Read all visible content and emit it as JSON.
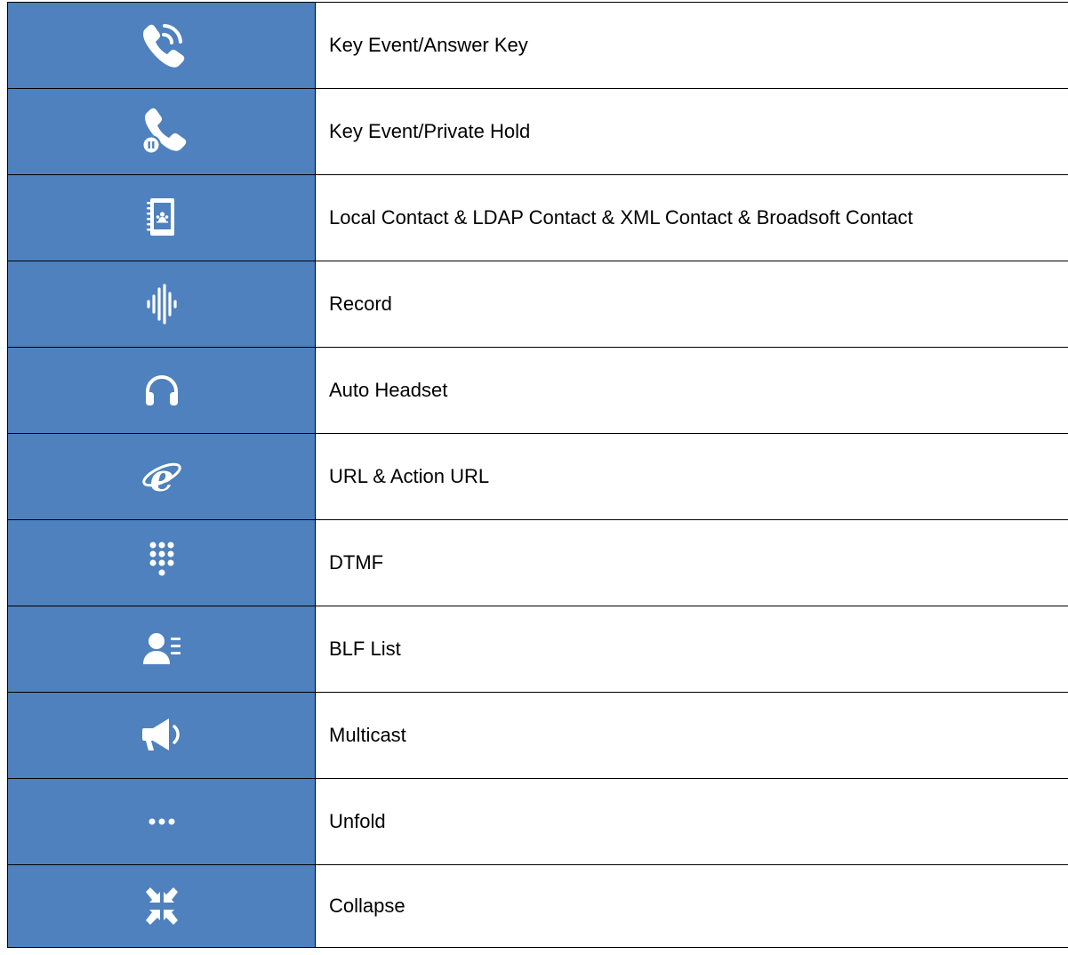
{
  "table": {
    "rows": [
      {
        "icon": "phone-answer-icon",
        "label": "Key Event/Answer Key"
      },
      {
        "icon": "phone-hold-icon",
        "label": "Key Event/Private Hold"
      },
      {
        "icon": "contact-book-icon",
        "label": "Local Contact & LDAP Contact & XML Contact & Broadsoft Contact"
      },
      {
        "icon": "sound-wave-icon",
        "label": "Record"
      },
      {
        "icon": "headset-icon",
        "label": "Auto Headset"
      },
      {
        "icon": "internet-explorer-icon",
        "label": "URL & Action URL"
      },
      {
        "icon": "dialpad-icon",
        "label": "DTMF"
      },
      {
        "icon": "contact-list-icon",
        "label": "BLF List"
      },
      {
        "icon": "megaphone-icon",
        "label": "Multicast"
      },
      {
        "icon": "ellipsis-icon",
        "label": "Unfold"
      },
      {
        "icon": "collapse-arrows-icon",
        "label": "Collapse"
      }
    ]
  },
  "colors": {
    "icon_background": "#4e81bd",
    "icon_foreground": "#ffffff",
    "border": "#000000"
  }
}
